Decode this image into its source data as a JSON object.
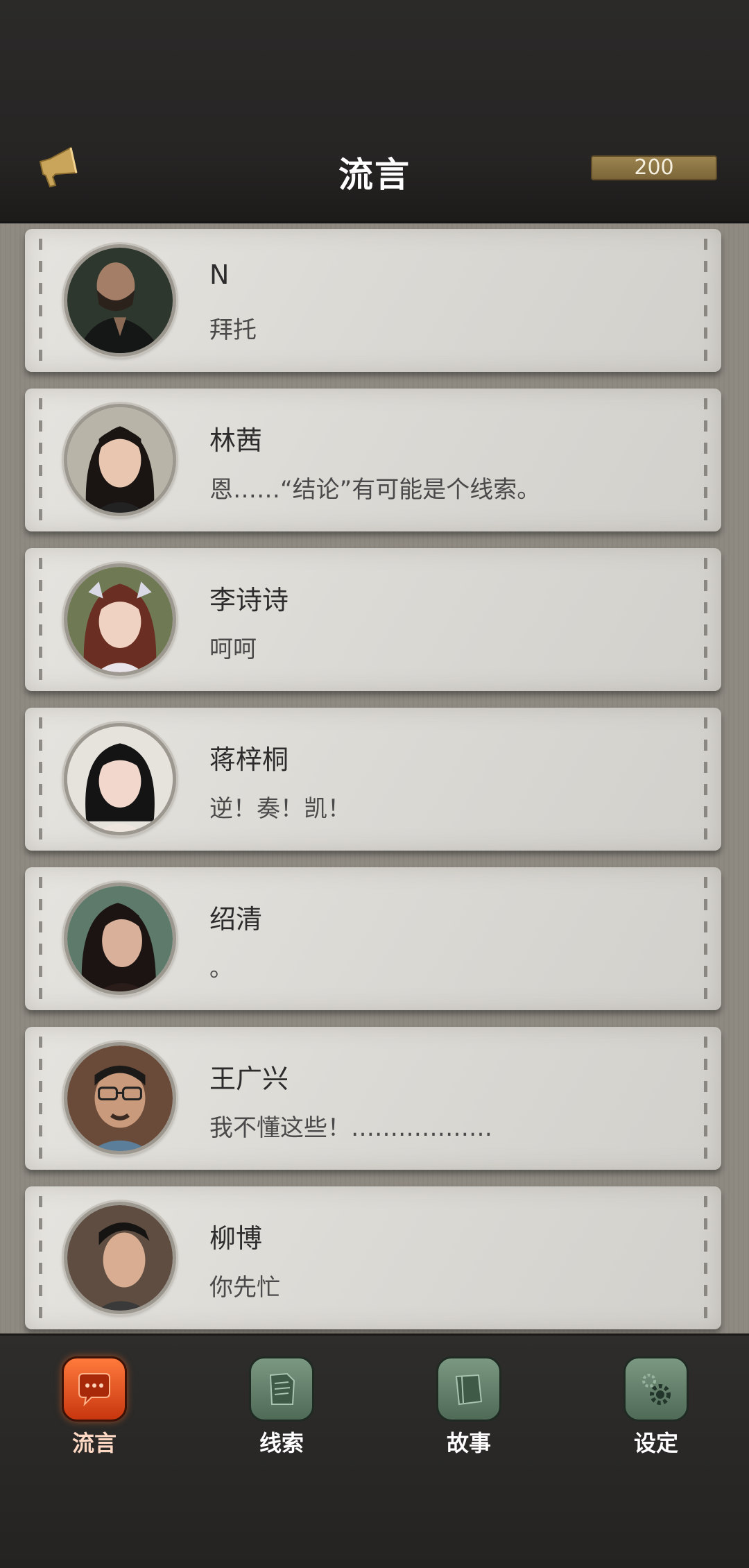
{
  "header": {
    "title": "流言",
    "currency_value": "200"
  },
  "contacts": [
    {
      "name": "N",
      "message": "拜托"
    },
    {
      "name": "林茜",
      "message": "恩……“结论”有可能是个线索。"
    },
    {
      "name": "李诗诗",
      "message": "呵呵"
    },
    {
      "name": "蒋梓桐",
      "message": "逆！奏！凯！"
    },
    {
      "name": "绍清",
      "message": "。"
    },
    {
      "name": "王广兴",
      "message": "我不懂这些！………………"
    },
    {
      "name": "柳博",
      "message": "你先忙"
    }
  ],
  "nav": [
    {
      "label": "流言",
      "icon": "chat-bubble-icon",
      "active": true
    },
    {
      "label": "线索",
      "icon": "document-icon",
      "active": false
    },
    {
      "label": "故事",
      "icon": "book-icon",
      "active": false
    },
    {
      "label": "设定",
      "icon": "gear-icon",
      "active": false
    }
  ],
  "colors": {
    "accent_active": "#e8541f",
    "nav_inactive": "#5f7d67",
    "currency_bar": "#8c7444"
  }
}
